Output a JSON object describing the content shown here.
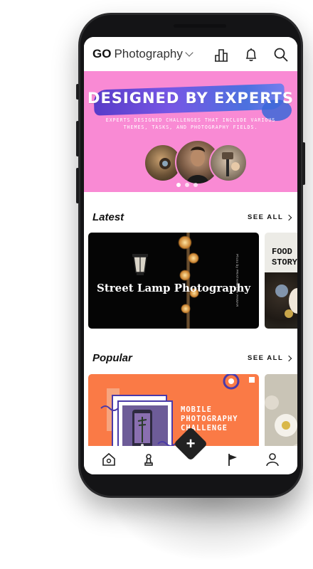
{
  "header": {
    "brand_prefix": "GO",
    "section_title": "Photography",
    "icons": [
      "chevron-down-icon",
      "leaderboard-icon",
      "bell-icon",
      "search-icon"
    ]
  },
  "banner": {
    "title": "DESIGNED BY EXPERTS",
    "subtitle": "EXPERTS DESIGNED CHALLENGES THAT INCLUDE VARIOUS THEMES, TASKS, AND PHOTOGRAPHY FIELDS.",
    "background_color": "#f98ad4",
    "brush_color": "#4a35c8"
  },
  "latest": {
    "title": "Latest",
    "see_all": "SEE ALL",
    "cards": [
      {
        "title": "Street Lamp Photography",
        "credit": "Photo by PRATHAMESH PAWAR"
      },
      {
        "title": "FOOD STORY"
      }
    ]
  },
  "popular": {
    "title": "Popular",
    "see_all": "SEE ALL",
    "cards": [
      {
        "title": "MOBILE PHOTOGRAPHY CHALLENGE",
        "background_color": "#fa7a46"
      }
    ]
  },
  "bottom_nav": {
    "items": [
      "home-icon",
      "trophy-icon",
      "plus-icon",
      "flag-icon",
      "profile-icon"
    ],
    "fab_label": "+"
  }
}
